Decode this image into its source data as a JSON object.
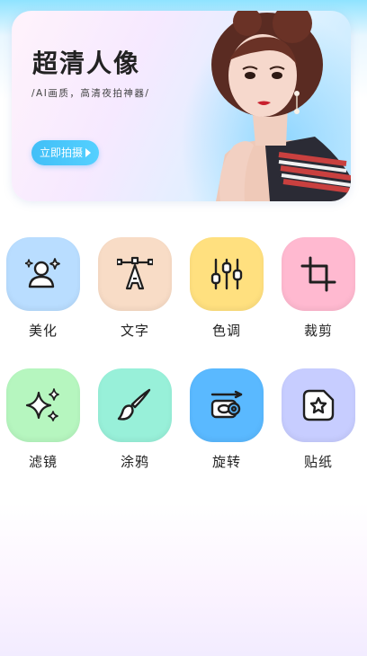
{
  "banner": {
    "title": "超清人像",
    "subtitle": "/AI画质，高清夜拍神器/",
    "button_label": "立即拍摄"
  },
  "tools": [
    {
      "label": "美化",
      "icon": "portrait-sparkle-icon",
      "color": "#b9ddff"
    },
    {
      "label": "文字",
      "icon": "pen-tool-text-icon",
      "color": "#f8dcc6"
    },
    {
      "label": "色调",
      "icon": "sliders-icon",
      "color": "#ffe07f"
    },
    {
      "label": "裁剪",
      "icon": "crop-icon",
      "color": "#ffb9d0"
    },
    {
      "label": "滤镜",
      "icon": "sparkle-icon",
      "color": "#b6f6bf"
    },
    {
      "label": "涂鸦",
      "icon": "paintbrush-icon",
      "color": "#98f0d9"
    },
    {
      "label": "旋转",
      "icon": "rotate-card-icon",
      "color": "#5ab9ff"
    },
    {
      "label": "贴纸",
      "icon": "star-sticker-icon",
      "color": "#c7cdff"
    }
  ]
}
